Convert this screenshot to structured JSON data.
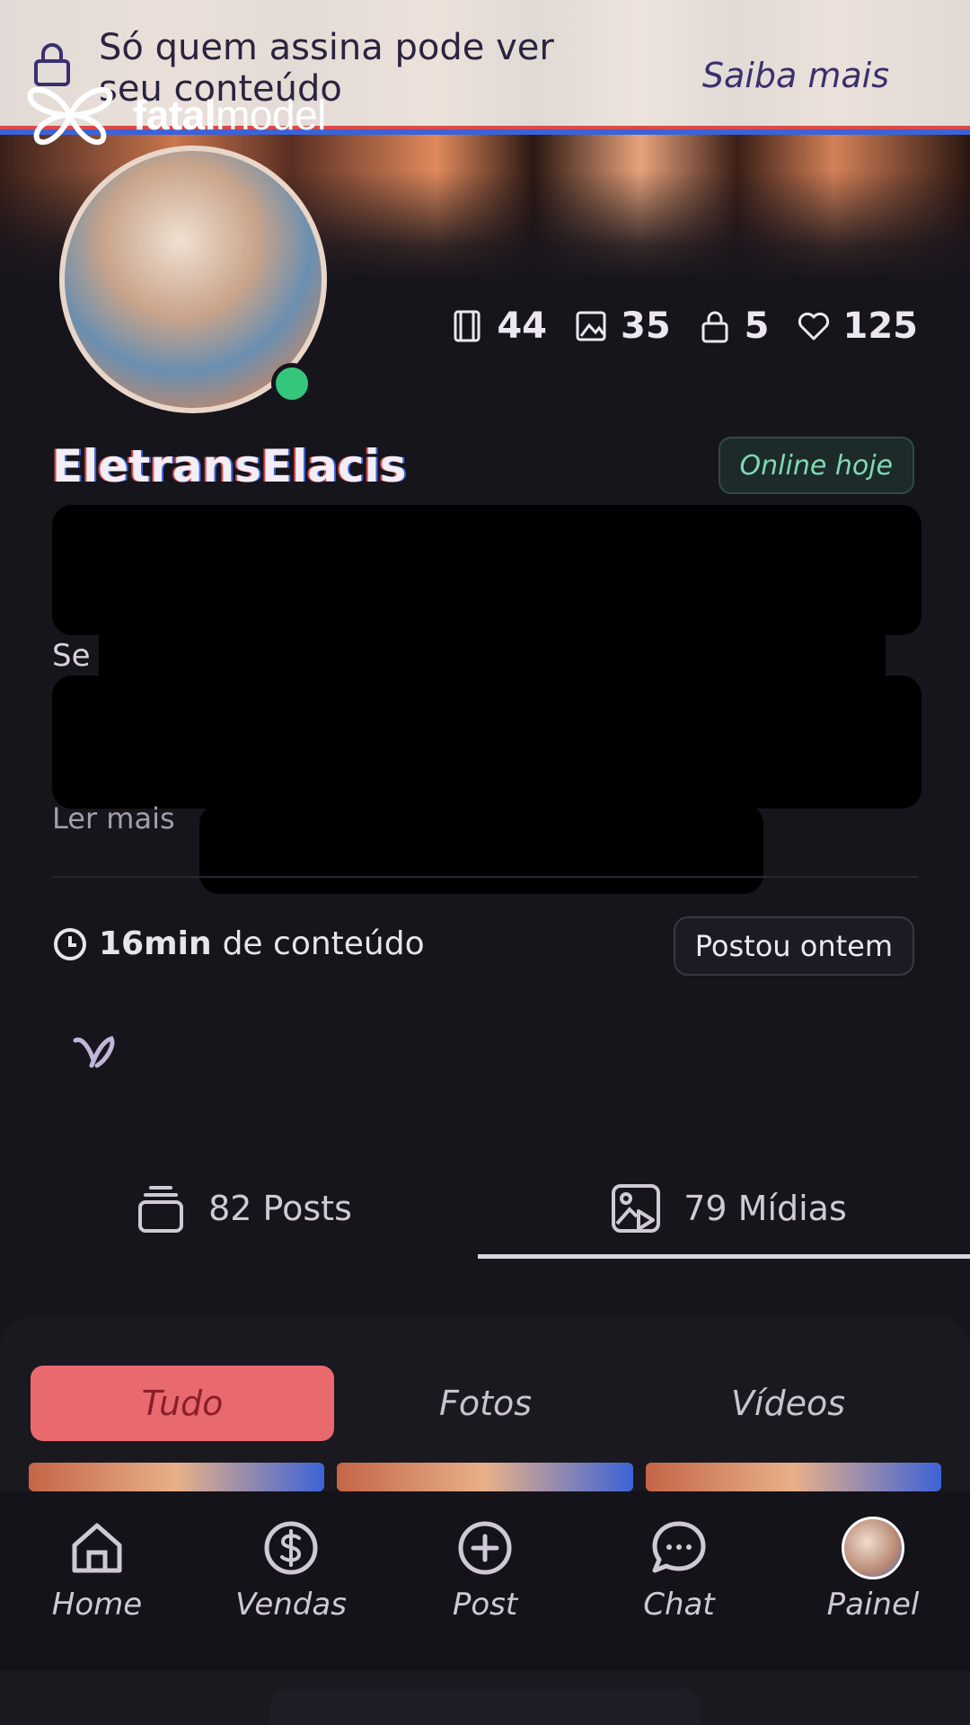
{
  "banner": {
    "text": "Só quem assina pode ver seu conteúdo",
    "link": "Saiba mais",
    "icon": "lock-icon"
  },
  "brand": {
    "name_bold": "fatal",
    "name_light": "model",
    "icon": "butterfly-logo-icon"
  },
  "profile": {
    "username": "EletransElacis",
    "status_badge": "Online hoje",
    "online_indicator_color": "#34c77b",
    "bio_peek": "Se",
    "read_more": "Ler mais"
  },
  "stats": [
    {
      "icon": "video-icon",
      "value": "44"
    },
    {
      "icon": "photo-icon",
      "value": "35"
    },
    {
      "icon": "locked-post-icon",
      "value": "5"
    },
    {
      "icon": "heart-icon",
      "value": "125"
    }
  ],
  "content": {
    "duration": "16min",
    "duration_suffix": "de conteúdo",
    "posted": "Postou ontem"
  },
  "tabs": {
    "posts": "82 Posts",
    "media": "79 Mídias",
    "active": "media"
  },
  "filters": {
    "all": "Tudo",
    "photos": "Fotos",
    "videos": "Vídeos",
    "active": "all",
    "active_color": "#e86a6f"
  },
  "nav": {
    "home": "Home",
    "sales": "Vendas",
    "post": "Post",
    "chat": "Chat",
    "panel": "Painel"
  }
}
